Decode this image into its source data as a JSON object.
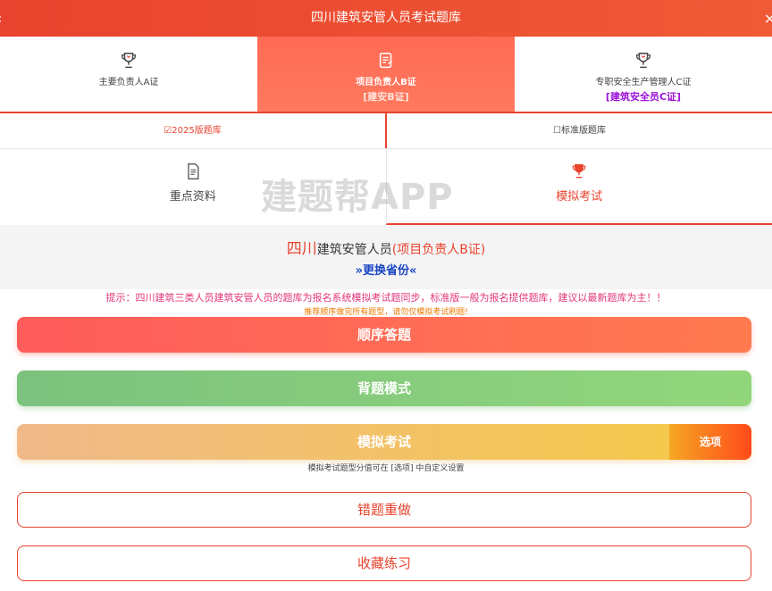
{
  "header": {
    "title": "四川建筑安管人员考试题库"
  },
  "certs": [
    {
      "name": "主要负责人A证",
      "sub": ""
    },
    {
      "name": "项目负责人B证",
      "sub": "[建安B证]"
    },
    {
      "name": "专职安全生产管理人C证",
      "sub": "[建筑安全员C证]"
    }
  ],
  "versions": [
    {
      "label": "☑2025版题库"
    },
    {
      "label": "☐标准版题库"
    }
  ],
  "features": [
    {
      "label": "重点资料"
    },
    {
      "label": "模拟考试"
    }
  ],
  "watermark": "建题帮APP",
  "region": {
    "province": "四川",
    "role": "建筑安管人员",
    "cert": "(项目负责人B证)",
    "switch": "»更换省份«"
  },
  "tips": {
    "main": "提示：四川建筑三类人员建筑安管人员的题库为报名系统模拟考试题同步，标准版一般为报名提供题库，建议以最新题库为主！！",
    "sub": "推荐顺序做完所有题型，请勿仅模拟考试刷题!"
  },
  "buttons": {
    "order": "顺序答题",
    "recite": "背题模式",
    "exam": "模拟考试",
    "exam_option": "选项",
    "exam_note": "模拟考试题型分值可在 [选项] 中自定义设置",
    "wrong": "错题重做",
    "favorite": "收藏练习"
  },
  "colors": {
    "accent": "#e8432e",
    "green": "#7cc27e",
    "yellow": "#f5c94c",
    "link": "#1845c4",
    "tip": "#e0367a"
  }
}
